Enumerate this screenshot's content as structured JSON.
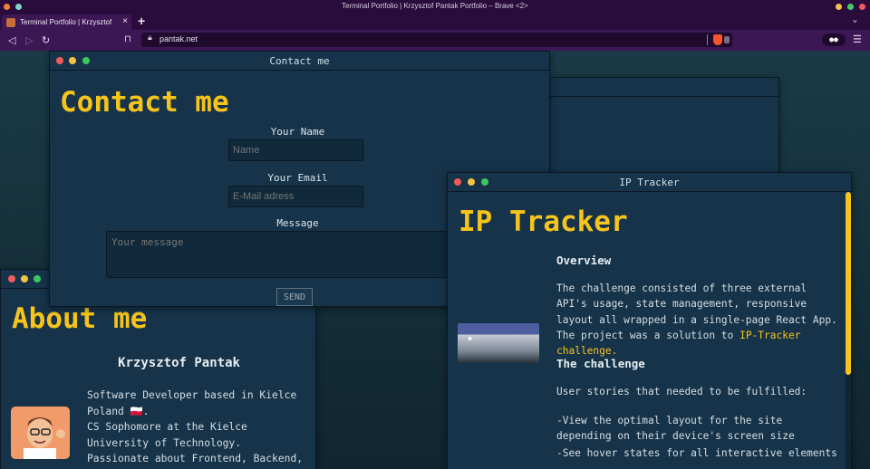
{
  "browser": {
    "window_title": "Terminal Portfolio | Krzysztof Pantak Portfolio – Brave <2>",
    "tab_label": "Terminal Portfolio | Krzysztof",
    "tab_close": "×",
    "new_tab": "+",
    "tab_list": "⌄",
    "url": "pantak.net",
    "colors": {
      "chrome": "#2a0c3c",
      "toolbar": "#3c1754",
      "urlbar": "#1f0a2e"
    }
  },
  "theme": {
    "background": "#16323f",
    "window": "#163349",
    "accent": "#f7c41b"
  },
  "windows": {
    "contact": {
      "bar_title": "Contact me",
      "heading": "Contact me",
      "name_label": "Your Name",
      "name_placeholder": "Name",
      "email_label": "Your Email",
      "email_placeholder": "E-Mail adress",
      "message_label": "Message",
      "message_placeholder": "Your message",
      "send_label": "SEND"
    },
    "about": {
      "heading": "About me",
      "name": "Krzysztof Pantak",
      "bio_1": "Software Developer based in Kielce Poland 🇵🇱.",
      "bio_2": "CS Sophomore at the Kielce University of Technology.",
      "bio_3": "Passionate about Frontend, Backend,"
    },
    "ip_tracker": {
      "bar_title": "IP Tracker",
      "heading": "IP Tracker",
      "overview_heading": "Overview",
      "overview_text": "The challenge consisted of three external API's usage, state management, responsive layout all wrapped in a single-page React App. The project was a solution to",
      "overview_link": "IP-Tracker challenge.",
      "challenge_heading": "The challenge",
      "stories_intro": "User stories that needed to be fulfilled:",
      "story_1": "-View the optimal layout for the site depending on their device's screen size",
      "story_2": "-See hover states for all interactive elements"
    }
  }
}
